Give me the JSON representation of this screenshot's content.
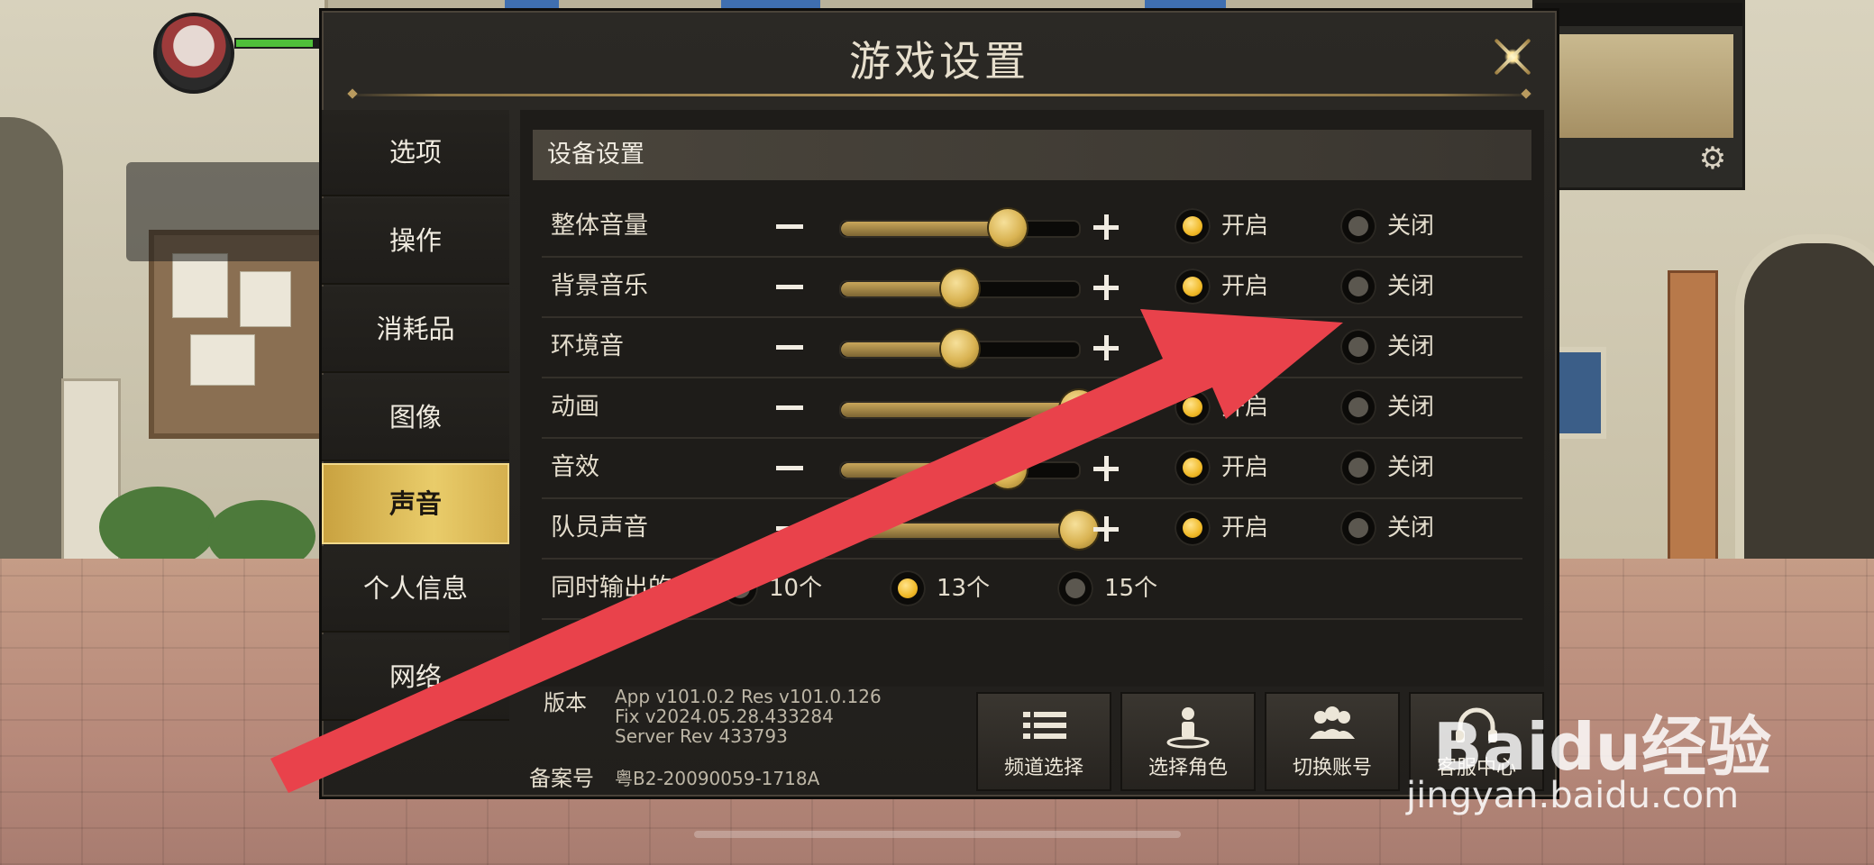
{
  "dialog": {
    "title": "游戏设置"
  },
  "tabs": [
    {
      "label": "选项",
      "active": false
    },
    {
      "label": "操作",
      "active": false
    },
    {
      "label": "消耗品",
      "active": false
    },
    {
      "label": "图像",
      "active": false
    },
    {
      "label": "声音",
      "active": true
    },
    {
      "label": "个人信息",
      "active": false
    },
    {
      "label": "网络",
      "active": false
    }
  ],
  "section": {
    "title": "设备设置"
  },
  "sliders": [
    {
      "label": "整体音量",
      "level": 0.7,
      "on_label": "开启",
      "off_label": "关闭",
      "state": "on"
    },
    {
      "label": "背景音乐",
      "level": 0.5,
      "on_label": "开启",
      "off_label": "关闭",
      "state": "on"
    },
    {
      "label": "环境音",
      "level": 0.5,
      "on_label": "开启",
      "off_label": "关闭",
      "state": "off"
    },
    {
      "label": "动画",
      "level": 1.0,
      "on_label": "开启",
      "off_label": "关闭",
      "state": "on"
    },
    {
      "label": "音效",
      "level": 0.7,
      "on_label": "开启",
      "off_label": "关闭",
      "state": "on"
    },
    {
      "label": "队员声音",
      "level": 1.0,
      "on_label": "开启",
      "off_label": "关闭",
      "state": "on"
    }
  ],
  "output": {
    "label": "同时输出的音效",
    "options": [
      "10个",
      "13个",
      "15个"
    ],
    "selected": 1
  },
  "version": {
    "label": "版本",
    "line1": "App v101.0.2 Res v101.0.126",
    "line2": "Fix v2024.05.28.433284",
    "line3": "Server Rev 433793"
  },
  "record": {
    "label": "备案号",
    "value": "粤B2-20090059-1718A"
  },
  "footer_buttons": [
    {
      "label": "频道选择",
      "icon": "list-icon"
    },
    {
      "label": "选择角色",
      "icon": "character-icon"
    },
    {
      "label": "切换账号",
      "icon": "users-icon"
    },
    {
      "label": "客服中心",
      "icon": "headset-icon"
    }
  ],
  "watermark": {
    "brand": "Baidu经验",
    "url": "jingyan.baidu.com"
  },
  "colors": {
    "accent_gold": "#e9cc6a",
    "arrow_red": "#e9424b"
  }
}
